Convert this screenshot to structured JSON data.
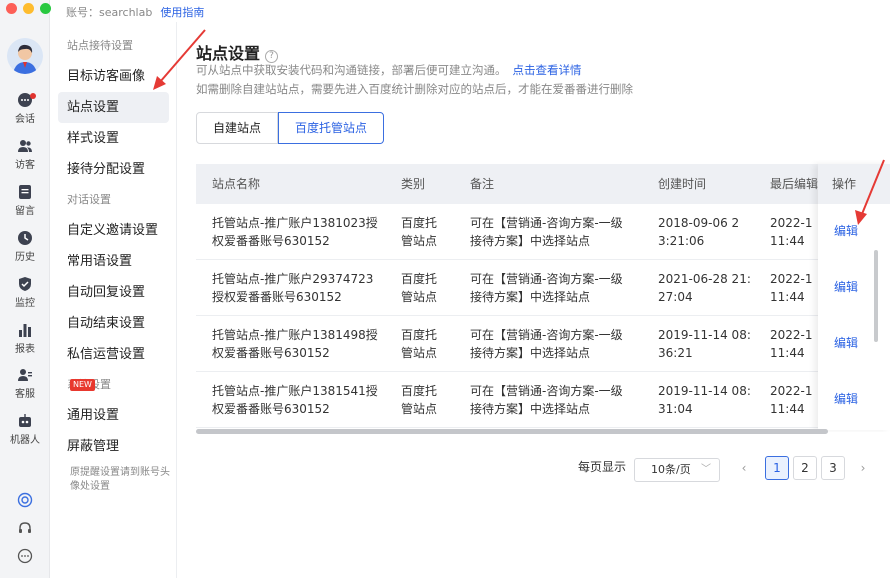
{
  "account": {
    "label": "账号：searchlab",
    "guide_link": "使用指南"
  },
  "rail": {
    "items": [
      {
        "label": "会话",
        "icon": "chat-icon"
      },
      {
        "label": "访客",
        "icon": "visitors-icon"
      },
      {
        "label": "留言",
        "icon": "message-icon"
      },
      {
        "label": "历史",
        "icon": "history-icon"
      },
      {
        "label": "监控",
        "icon": "monitor-icon"
      },
      {
        "label": "报表",
        "icon": "report-icon"
      },
      {
        "label": "客服",
        "icon": "agent-icon"
      },
      {
        "label": "机器人",
        "icon": "robot-icon"
      }
    ],
    "bottom_icons": [
      "target-icon",
      "headset-icon",
      "more-icon"
    ]
  },
  "menu": {
    "group_reception": "站点接待设置",
    "visitor_profile": "目标访客画像",
    "site_settings": "站点设置",
    "style_settings": "样式设置",
    "reception_assign": "接待分配设置",
    "group_dialog": "对话设置",
    "custom_invite": "自定义邀请设置",
    "common_phrases": "常用语设置",
    "auto_reply": "自动回复设置",
    "auto_end": "自动结束设置",
    "private_msg": "私信运营设置",
    "new_badge": "NEW",
    "group_system": "系统设置",
    "general": "通用设置",
    "block": "屏蔽管理",
    "note": "原提醒设置请到账号头像处设置"
  },
  "page": {
    "title": "站点设置",
    "help_glyph": "?",
    "desc1": "可从站点中获取安装代码和沟通链接，部署后便可建立沟通。",
    "desc1_link": "点击查看详情",
    "desc2": "如需删除自建站站点，需要先进入百度统计删除对应的站点后，才能在爱番番进行删除"
  },
  "tabs": {
    "self_built": "自建站点",
    "baidu_hosted": "百度托管站点",
    "active": "baidu_hosted"
  },
  "table": {
    "headers": {
      "name": "站点名称",
      "type": "类别",
      "remark": "备注",
      "created": "创建时间",
      "last_edit": "最后编辑",
      "ops": "操作"
    },
    "rows": [
      {
        "name_1": "托管站点-推广账户1381023授",
        "name_2": "权爱番番账号630152",
        "type_1": "百度托",
        "type_2": "管站点",
        "remark_1": "可在【营销通-咨询方案-一级",
        "remark_2": "接待方案】中选择站点",
        "created_1": "2018-09-06 2",
        "created_2": "3:21:06",
        "edit_1": "2022-1",
        "edit_2": "11:44",
        "op": "编辑"
      },
      {
        "name_1": "托管站点-推广账户29374723",
        "name_2": "授权爱番番账号630152",
        "type_1": "百度托",
        "type_2": "管站点",
        "remark_1": "可在【营销通-咨询方案-一级",
        "remark_2": "接待方案】中选择站点",
        "created_1": "2021-06-28 21:",
        "created_2": "27:04",
        "edit_1": "2022-1",
        "edit_2": "11:44",
        "op": "编辑"
      },
      {
        "name_1": "托管站点-推广账户1381498授",
        "name_2": "权爱番番账号630152",
        "type_1": "百度托",
        "type_2": "管站点",
        "remark_1": "可在【营销通-咨询方案-一级",
        "remark_2": "接待方案】中选择站点",
        "created_1": "2019-11-14 08:",
        "created_2": "36:21",
        "edit_1": "2022-1",
        "edit_2": "11:44",
        "op": "编辑"
      },
      {
        "name_1": "托管站点-推广账户1381541授",
        "name_2": "权爱番番账号630152",
        "type_1": "百度托",
        "type_2": "管站点",
        "remark_1": "可在【营销通-咨询方案-一级",
        "remark_2": "接待方案】中选择站点",
        "created_1": "2019-11-14 08:",
        "created_2": "31:04",
        "edit_1": "2022-1",
        "edit_2": "11:44",
        "op": "编辑"
      }
    ]
  },
  "pagination": {
    "per_page_label": "每页显示",
    "per_page_value": "10条/页",
    "prev": "‹",
    "next": "›",
    "pages": [
      "1",
      "2",
      "3"
    ],
    "current": "1"
  },
  "colors": {
    "accent": "#2b62e3",
    "annotation_arrow": "#e53a35",
    "new_badge": "#e8382e"
  }
}
